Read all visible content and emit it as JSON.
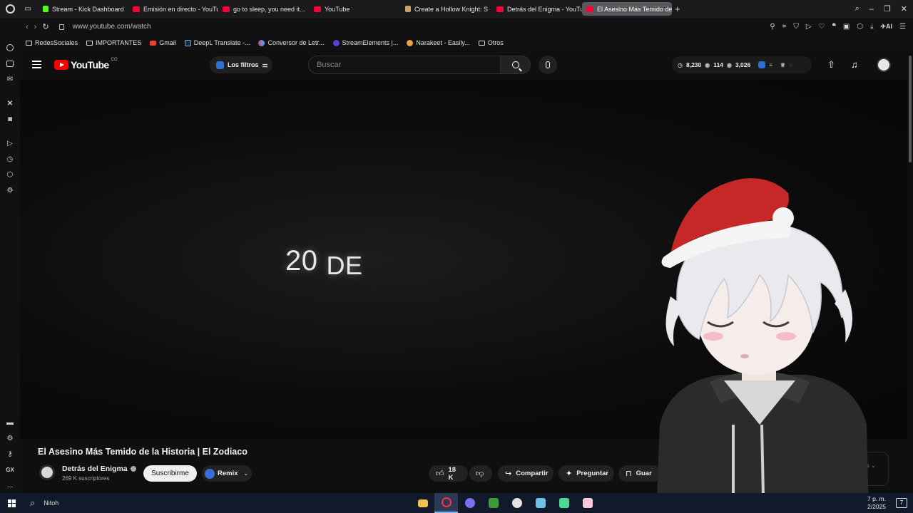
{
  "browser": {
    "tabs": [
      {
        "label": "Stream - Kick Dashboard",
        "favicon": "kick"
      },
      {
        "label": "Emisión en directo - YouTu",
        "favicon": "youtube"
      },
      {
        "label": "go to sleep, you need it...",
        "favicon": "youtube"
      },
      {
        "label": "YouTube",
        "favicon": "youtube"
      },
      {
        "label": "Create a Hollow Knight: S",
        "favicon": "doc"
      },
      {
        "label": "Detrás del Enigma - YouTu",
        "favicon": "youtube"
      },
      {
        "label": "El Asesino Más Temido de",
        "favicon": "youtube",
        "active": true
      }
    ],
    "url": "www.youtube.com/watch",
    "ai_label": "AI",
    "bookmarks": [
      {
        "label": "RedesSociales",
        "icon": "folder"
      },
      {
        "label": "IMPORTANTES",
        "icon": "folder"
      },
      {
        "label": "Gmail",
        "icon": "gmail"
      },
      {
        "label": "DeepL Translate -...",
        "icon": "deepl"
      },
      {
        "label": "Conversor de Letr...",
        "icon": "converter"
      },
      {
        "label": "StreamElements |...",
        "icon": "streamelements"
      },
      {
        "label": "Narakeet - Easily...",
        "icon": "narakeet"
      },
      {
        "label": "Otros",
        "icon": "folder"
      }
    ],
    "sidebar_labels": {
      "gx": "GX",
      "more": "..."
    }
  },
  "youtube": {
    "logo_text": "YouTube",
    "country_code": "CO",
    "filters_label": "Los filtros",
    "search_placeholder": "Buscar",
    "stats": {
      "views": "8,230",
      "watching": "114",
      "other": "3,026"
    },
    "video_overlay_text": {
      "number": "20",
      "word": "DE"
    },
    "video_title": "El Asesino Más Temido de la Historia | El Zodiaco",
    "channel_name": "Detrás del Enigma",
    "subscribers": "269 K suscriptores",
    "subscribe_label": "Suscribirme",
    "remix_label": "Remix",
    "likes": "18 K",
    "share_label": "Compartir",
    "ask_label": "Preguntar",
    "save_label": "Guar",
    "ghost_text": "ws"
  },
  "taskbar": {
    "search_label": "Nitoh",
    "time": "7 p. m.",
    "date": "2/2025",
    "notification_count": "7"
  },
  "colors": {
    "youtube_red": "#ff0000",
    "background": "#0f0f0f",
    "taskbar": "#101a2a"
  }
}
